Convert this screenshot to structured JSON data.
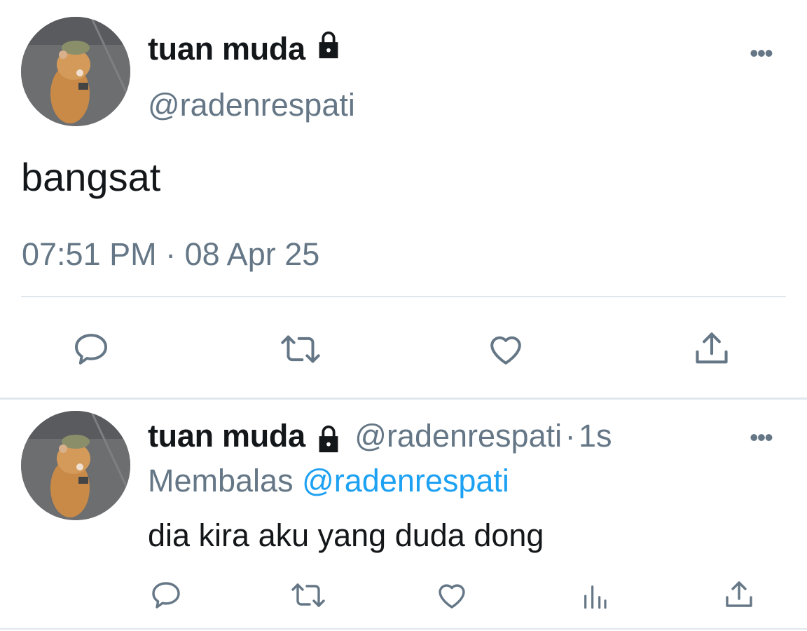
{
  "main_tweet": {
    "display_name": "tuan muda",
    "handle": "@radenrespati",
    "text": "bangsat",
    "timestamp": "07:51 PM · 08 Apr 25",
    "more_label": "•••",
    "protected": true,
    "actions": [
      "reply-icon",
      "retweet-icon",
      "like-icon",
      "share-icon"
    ]
  },
  "reply_tweet": {
    "display_name": "tuan muda",
    "handle": "@radenrespati",
    "separator": "·",
    "age": "1s",
    "replying_prefix": "Membalas",
    "replying_to": "@radenrespati",
    "text": "dia kira aku yang duda dong",
    "more_label": "•••",
    "protected": true,
    "actions": [
      "reply-icon",
      "retweet-icon",
      "like-icon",
      "analytics-icon",
      "share-icon"
    ]
  },
  "colors": {
    "text_primary": "#14171a",
    "text_secondary": "#657786",
    "link": "#1da1f2",
    "divider": "#e1e8ed"
  }
}
